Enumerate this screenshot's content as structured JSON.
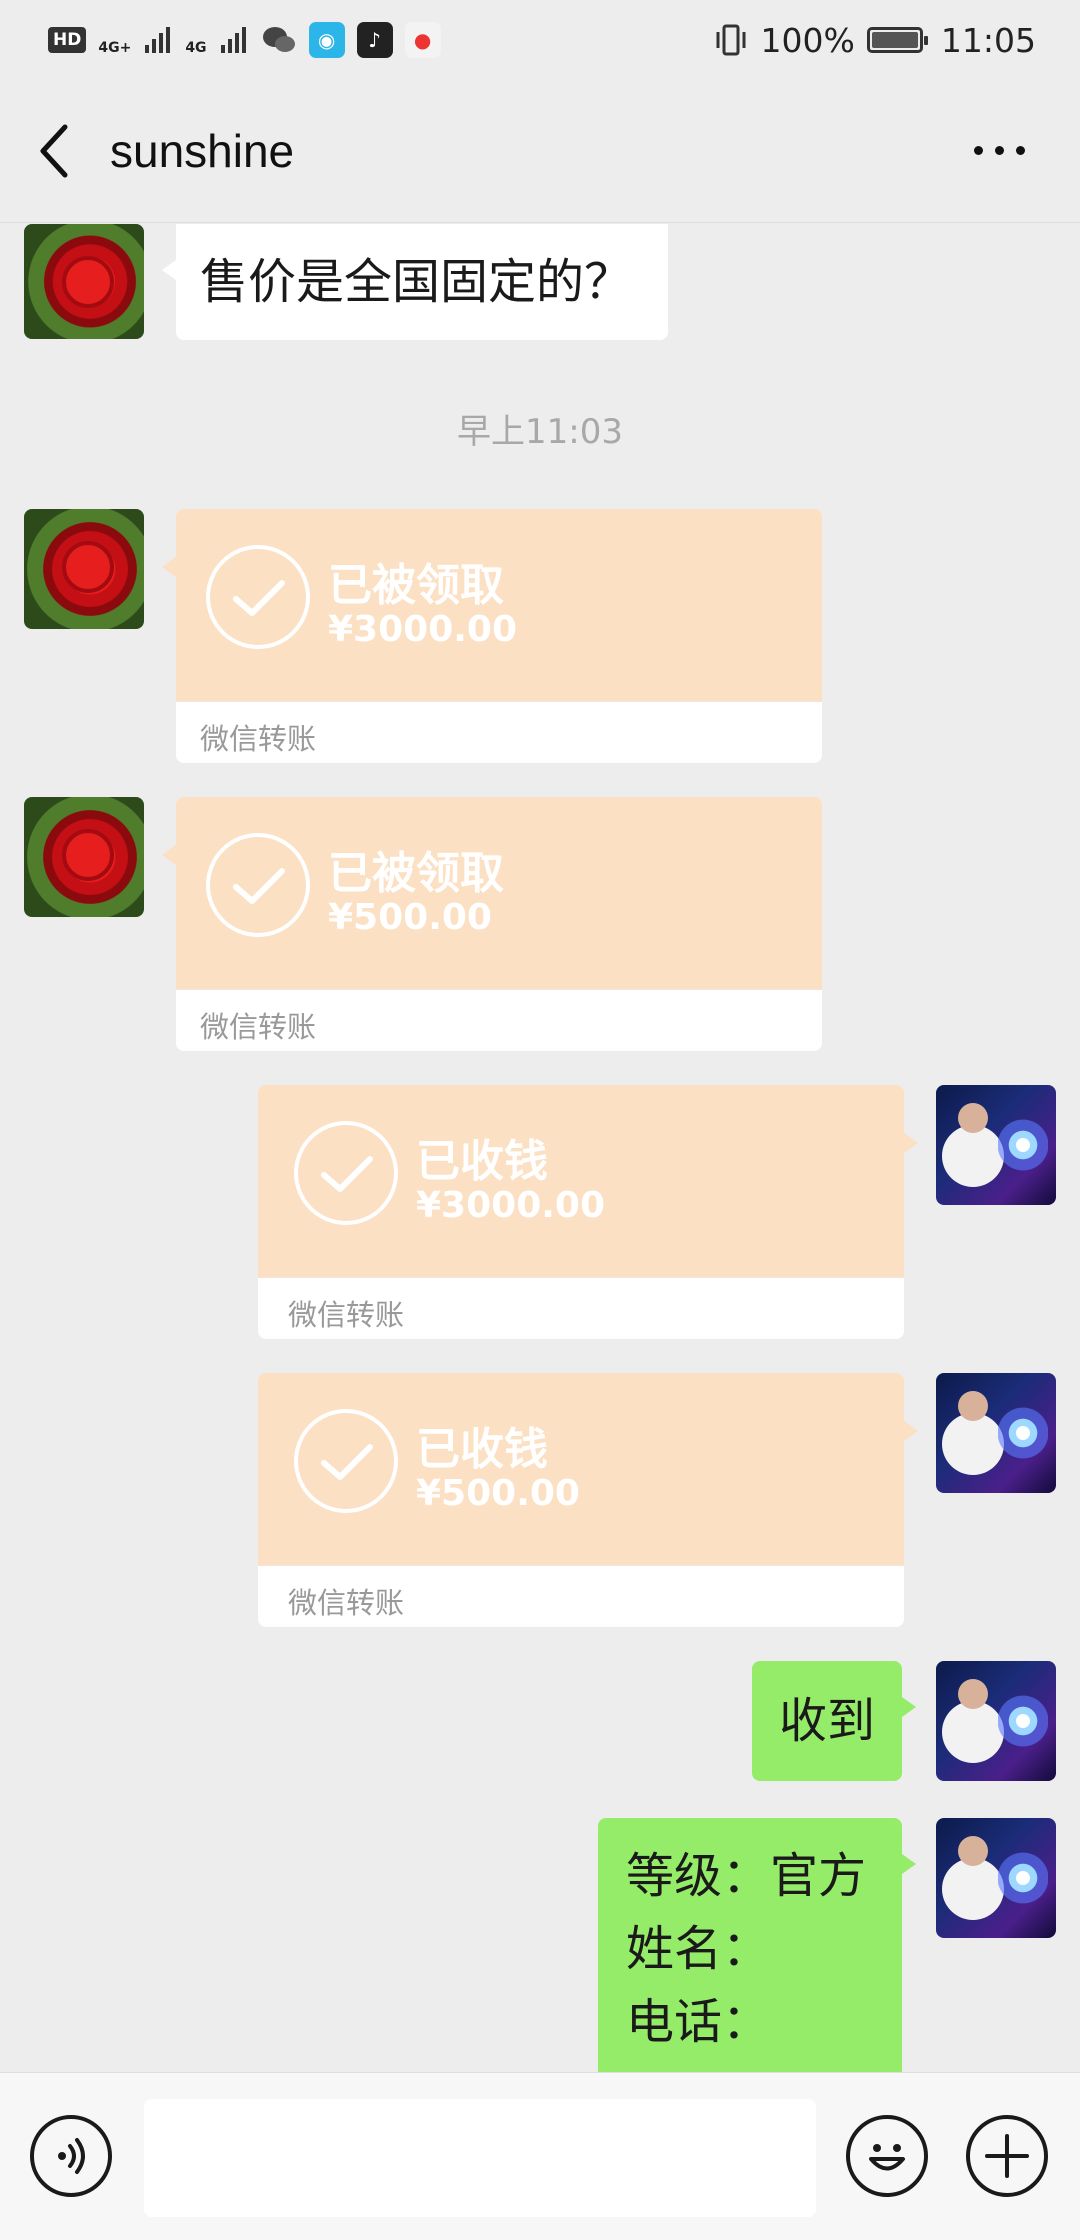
{
  "status_bar": {
    "hd": "HD",
    "net1": "4G+",
    "net2": "4G",
    "battery": "100%",
    "time": "11:05"
  },
  "header": {
    "title": "sunshine"
  },
  "messages": [
    {
      "type": "text",
      "side": "left",
      "avatar": "rose",
      "text": "售价是全国固定的？"
    },
    {
      "type": "time",
      "text": "早上11:03"
    },
    {
      "type": "transfer",
      "side": "left",
      "avatar": "rose",
      "status": "已被领取",
      "amount": "¥3000.00",
      "footer": "微信转账"
    },
    {
      "type": "transfer",
      "side": "left",
      "avatar": "rose",
      "status": "已被领取",
      "amount": "¥500.00",
      "footer": "微信转账"
    },
    {
      "type": "transfer",
      "side": "right",
      "avatar": "person",
      "status": "已收钱",
      "amount": "¥3000.00",
      "footer": "微信转账"
    },
    {
      "type": "transfer",
      "side": "right",
      "avatar": "person",
      "status": "已收钱",
      "amount": "¥500.00",
      "footer": "微信转账"
    },
    {
      "type": "text",
      "side": "right",
      "avatar": "person",
      "text": "收到"
    },
    {
      "type": "text",
      "side": "right",
      "avatar": "person",
      "lines": [
        "等级：官方",
        "姓名：",
        "电话："
      ]
    }
  ],
  "colors": {
    "background": "#ededed",
    "green_bubble": "#95ec69",
    "transfer_card": "#fbe0c3"
  },
  "icons": {
    "back": "chevron-left-icon",
    "more": "more-horizontal-icon",
    "voice": "voice-icon",
    "emoji": "emoji-icon",
    "plus": "plus-icon"
  }
}
